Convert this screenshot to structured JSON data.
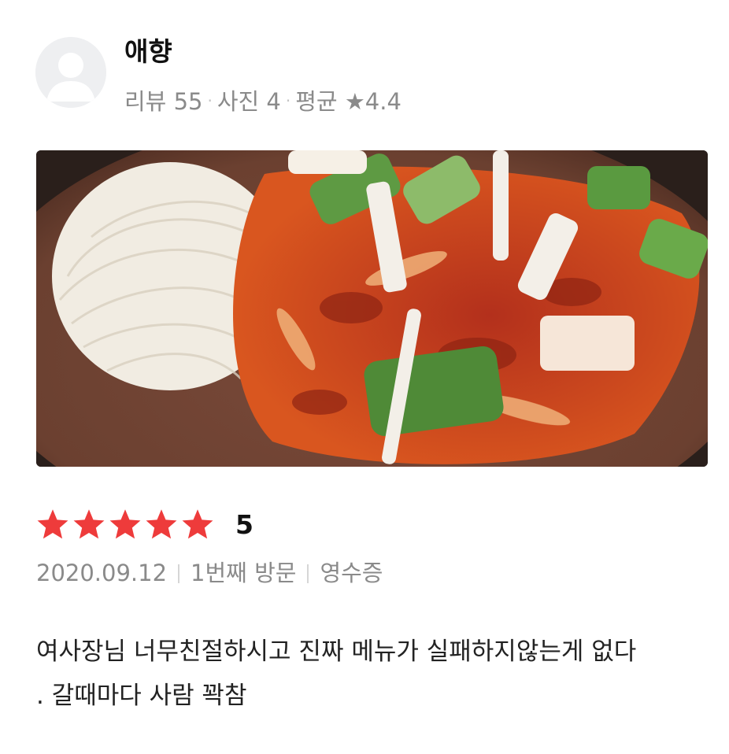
{
  "user": {
    "name": "애향",
    "review_count": "리뷰 55",
    "photo_count": "사진 4",
    "average": "평균 ★4.4"
  },
  "review": {
    "rating": "5",
    "stars_filled": 5,
    "star_color": "#ee3b3b",
    "date": "2020.09.12",
    "visit": "1번째 방문",
    "verification": "영수증",
    "text_line1": "여사장님 너무친절하시고 진짜 메뉴가 실패하지않는게 없다",
    "text_line2": ". 갈때마다 사람 꽉참"
  },
  "icons": {
    "avatar": "default-user-icon",
    "star": "star-icon"
  }
}
